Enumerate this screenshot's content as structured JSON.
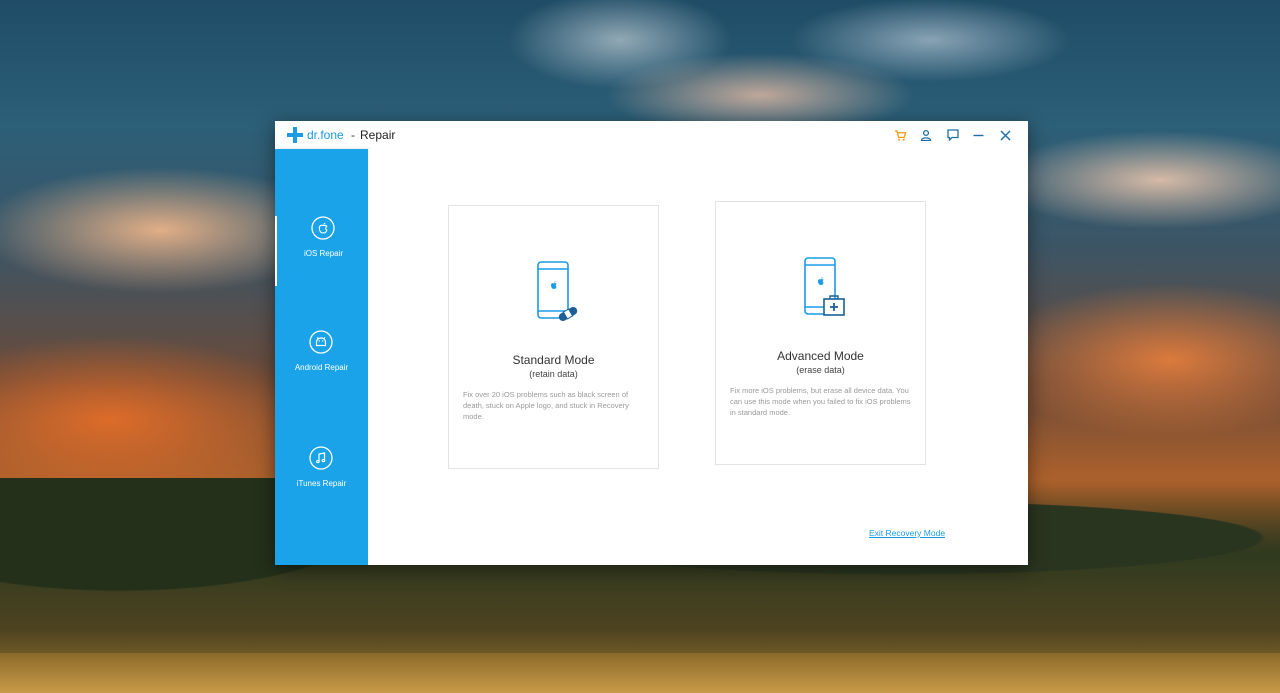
{
  "app": {
    "brand": "dr.fone",
    "separator": "-",
    "title": "Repair",
    "brand_color": "#1a9be6",
    "accent_orange": "#f39c12"
  },
  "titlebar_buttons": [
    {
      "icon": "cart-icon"
    },
    {
      "icon": "user-icon"
    },
    {
      "icon": "feedback-icon"
    },
    {
      "icon": "minimize-icon"
    },
    {
      "icon": "close-icon"
    }
  ],
  "sidebar": {
    "color": "#1ba3ea",
    "items": [
      {
        "label": "iOS Repair",
        "icon": "apple-icon",
        "active": true
      },
      {
        "label": "Android Repair",
        "icon": "android-icon",
        "active": false
      },
      {
        "label": "iTunes Repair",
        "icon": "music-note-icon",
        "active": false
      }
    ]
  },
  "modes": [
    {
      "title": "Standard Mode",
      "subtitle": "(retain data)",
      "description": "Fix over 20 iOS problems such as black screen of death, stuck on Apple logo, and stuck in Recovery mode.",
      "icon": "phone-bandage-icon"
    },
    {
      "title": "Advanced Mode",
      "subtitle": "(erase data)",
      "description": "Fix more iOS problems, but erase all device data. You can use this mode when you failed to fix iOS problems in standard mode.",
      "icon": "phone-medkit-icon"
    }
  ],
  "footer": {
    "exit_link": "Exit Recovery Mode"
  }
}
